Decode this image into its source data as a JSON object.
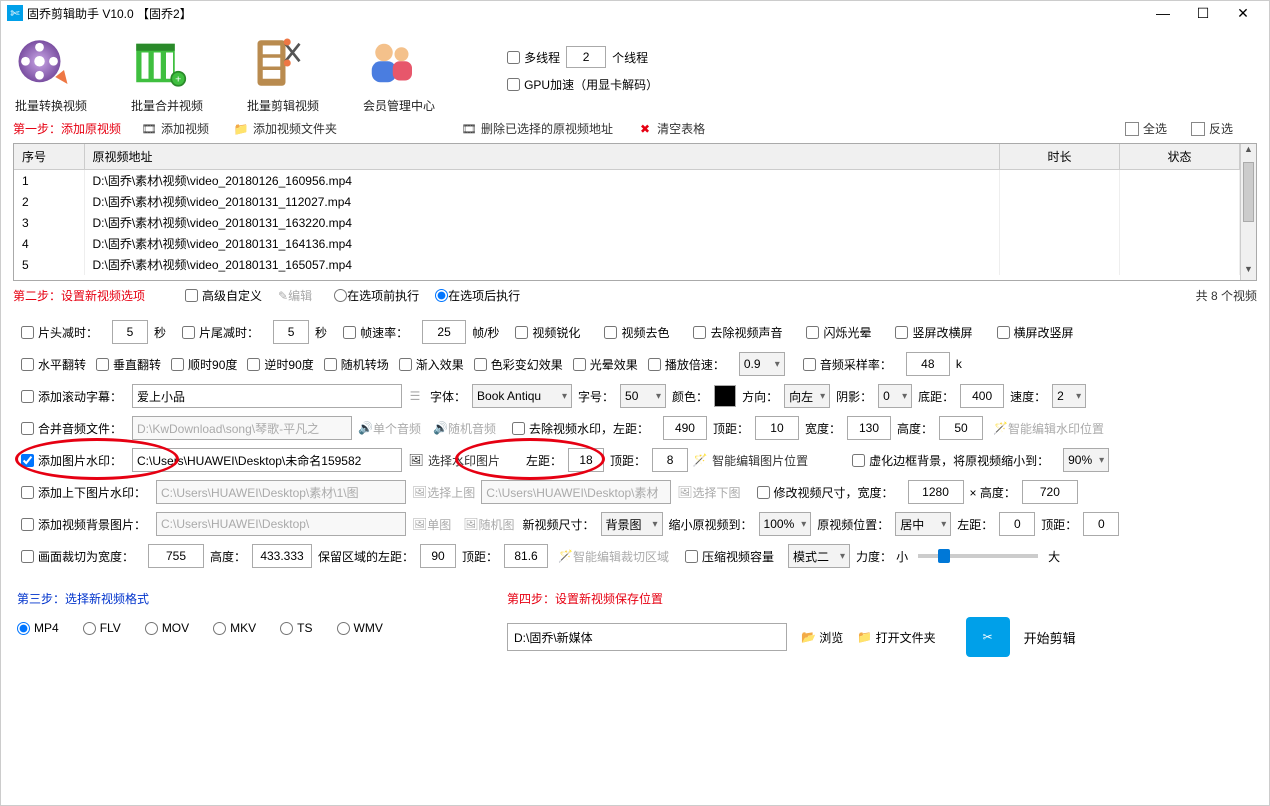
{
  "window": {
    "title": "固乔剪辑助手 V10.0   【固乔2】"
  },
  "toolbar": {
    "convert": "批量转换视频",
    "merge": "批量合并视频",
    "clip": "批量剪辑视频",
    "member": "会员管理中心"
  },
  "threads": {
    "multithread_label": "多线程",
    "thread_count": "2",
    "thread_unit": "个线程",
    "gpu_label": "GPU加速（用显卡解码）"
  },
  "step1": {
    "label": "第一步：添加原视频",
    "add_video": "添加视频",
    "add_folder": "添加视频文件夹",
    "delete_selected": "删除已选择的原视频地址",
    "clear": "清空表格",
    "select_all": "全选",
    "invert": "反选",
    "col_index": "序号",
    "col_path": "原视频地址",
    "col_duration": "时长",
    "col_status": "状态",
    "rows": [
      {
        "idx": "1",
        "path": "D:\\固乔\\素材\\视频\\video_20180126_160956.mp4"
      },
      {
        "idx": "2",
        "path": "D:\\固乔\\素材\\视频\\video_20180131_112027.mp4"
      },
      {
        "idx": "3",
        "path": "D:\\固乔\\素材\\视频\\video_20180131_163220.mp4"
      },
      {
        "idx": "4",
        "path": "D:\\固乔\\素材\\视频\\video_20180131_164136.mp4"
      },
      {
        "idx": "5",
        "path": "D:\\固乔\\素材\\视频\\video_20180131_165057.mp4"
      }
    ]
  },
  "step2": {
    "label": "第二步：设置新视频选项",
    "adv": "高级自定义",
    "edit": "编辑",
    "before": "在选项前执行",
    "after": "在选项后执行",
    "total": "共 8 个视频",
    "row1": {
      "head_trim": "片头减时：",
      "head_val": "5",
      "sec": "秒",
      "tail_trim": "片尾减时：",
      "tail_val": "5",
      "fps_lbl": "帧速率：",
      "fps_val": "25",
      "fps_unit": "帧/秒",
      "sharpen": "视频锐化",
      "decolor": "视频去色",
      "mute": "去除视频声音",
      "flash": "闪烁光晕",
      "v2h": "竖屏改横屏",
      "h2v": "横屏改竖屏"
    },
    "row2": {
      "hflip": "水平翻转",
      "vflip": "垂直翻转",
      "cw90": "顺时90度",
      "ccw90": "逆时90度",
      "random_trans": "随机转场",
      "fadein": "渐入效果",
      "color_fx": "色彩变幻效果",
      "halo": "光晕效果",
      "speed_lbl": "播放倍速：",
      "speed_val": "0.9",
      "sr_lbl": "音频采样率：",
      "sr_val": "48",
      "sr_unit": "k"
    },
    "row3": {
      "scroll_text_lbl": "添加滚动字幕：",
      "scroll_text_val": "爱上小品",
      "font_lbl": "字体：",
      "font_val": "Book Antiqu",
      "size_lbl": "字号：",
      "size_val": "50",
      "color_lbl": "颜色：",
      "dir_lbl": "方向：",
      "dir_val": "向左",
      "shadow_lbl": "阴影：",
      "shadow_val": "0",
      "base_lbl": "底距：",
      "base_val": "400",
      "speed_lbl": "速度：",
      "speed_val": "2"
    },
    "row4": {
      "merge_audio_lbl": "合并音频文件：",
      "merge_audio_val": "D:\\KwDownload\\song\\琴歌-平凡之",
      "single_audio": "单个音频",
      "random_audio": "随机音频",
      "rm_wm": "去除视频水印，左距：",
      "left": "490",
      "top_lbl": "顶距：",
      "top": "10",
      "w_lbl": "宽度：",
      "w": "130",
      "h_lbl": "高度：",
      "h": "50",
      "smart": "智能编辑水印位置"
    },
    "row5": {
      "add_img_wm": "添加图片水印：",
      "wm_path": "C:\\Users\\HUAWEI\\Desktop\\未命名159582",
      "choose_wm": "选择水印图片",
      "left_lbl": "左距：",
      "left": "18",
      "top_lbl": "顶距：",
      "top": "8",
      "smart_pos": "智能编辑图片位置",
      "blur_bg": "虚化边框背景，将原视频缩小到：",
      "blur_val": "90%"
    },
    "row6": {
      "tb_wm": "添加上下图片水印：",
      "tb_top": "C:\\Users\\HUAWEI\\Desktop\\素材\\1\\图",
      "choose_top": "选择上图",
      "tb_bot": "C:\\Users\\HUAWEI\\Desktop\\素材",
      "choose_bot": "选择下图",
      "resize_lbl": "修改视频尺寸，宽度：",
      "w": "1280",
      "x": "× 高度：",
      "h": "720"
    },
    "row7": {
      "bg_img": "添加视频背景图片：",
      "bg_path": "C:\\Users\\HUAWEI\\Desktop\\",
      "single_img": "单图",
      "random_img": "随机图",
      "new_size_lbl": "新视频尺寸：",
      "new_size_val": "背景图",
      "shrink_lbl": "缩小原视频到：",
      "shrink_val": "100%",
      "pos_lbl": "原视频位置：",
      "pos_val": "居中",
      "left_lbl": "左距：",
      "left": "0",
      "top_lbl": "顶距：",
      "top": "0"
    },
    "row8": {
      "crop_lbl": "画面裁切为宽度：",
      "w": "755",
      "h_lbl": "高度：",
      "h": "433.333",
      "keep_left_lbl": "保留区域的左距：",
      "left": "90",
      "top_lbl": "顶距：",
      "top": "81.6",
      "smart_crop": "智能编辑裁切区域",
      "compress_lbl": "压缩视频容量",
      "mode_val": "模式二",
      "force_lbl": "力度：",
      "small": "小",
      "big": "大"
    }
  },
  "step3": {
    "label": "第三步：选择新视频格式",
    "formats": [
      "MP4",
      "FLV",
      "MOV",
      "MKV",
      "TS",
      "WMV"
    ],
    "selected": "MP4"
  },
  "step4": {
    "label": "第四步：设置新视频保存位置",
    "path": "D:\\固乔\\新媒体",
    "browse": "浏览",
    "open_folder": "打开文件夹",
    "start": "开始剪辑"
  }
}
